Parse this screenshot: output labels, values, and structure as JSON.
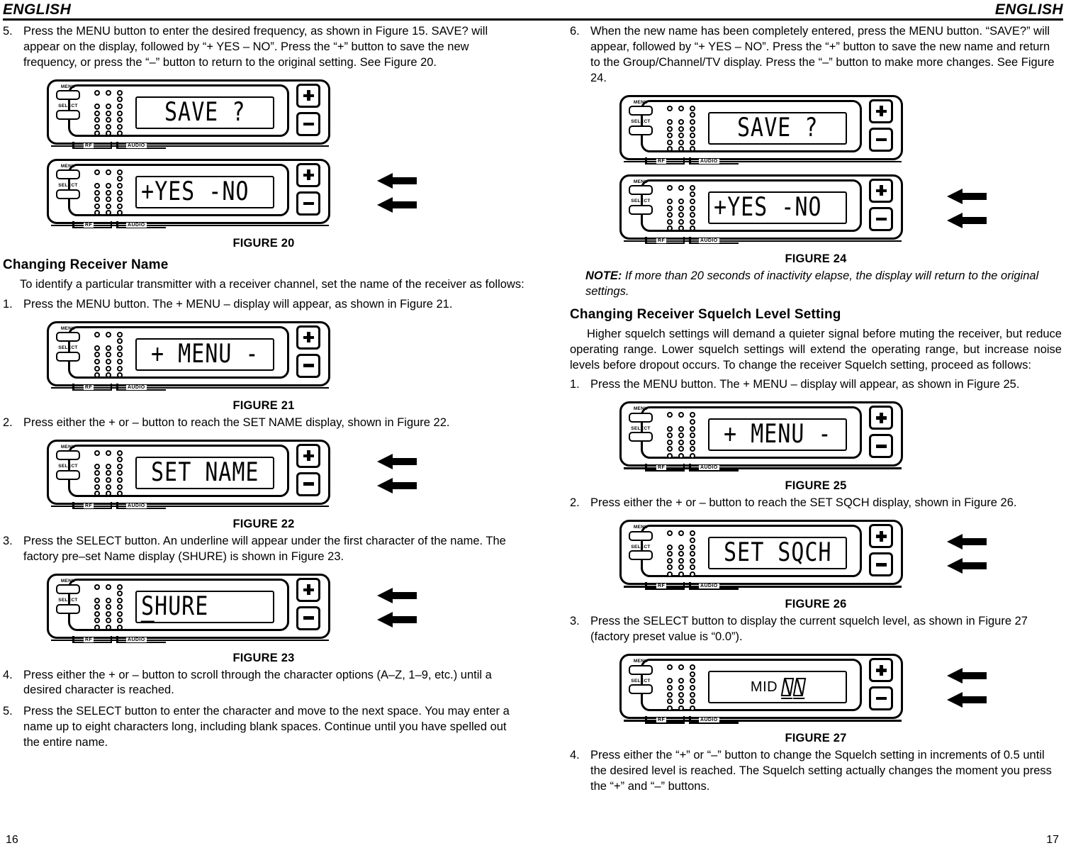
{
  "header": {
    "left_word": "ENGLISH",
    "right_word": "ENGLISH"
  },
  "page_numbers": {
    "left": "16",
    "right": "17"
  },
  "left_column": {
    "step5": {
      "num": "5.",
      "text": "Press the MENU button to enter the desired frequency, as shown in Figure 15. SAVE? will appear on the display, followed by “+ YES – NO”. Press the “+” button to save the new frequency, or press the “–” button to return to the original setting. See Figure 20."
    },
    "figure20": {
      "caption": "FIGURE 20",
      "panel_a": {
        "lcd": "SAVE ?",
        "align": "center"
      },
      "panel_b": {
        "lcd": "+YES -NO",
        "align": "left"
      }
    },
    "section_title": "Changing Receiver Name",
    "intro": "To identify a particular transmitter with a receiver channel, set the name of the receiver as follows:",
    "step1": {
      "num": "1.",
      "text": "Press the MENU button. The + MENU – display will appear, as shown in Figure 21."
    },
    "figure21": {
      "caption": "FIGURE 21",
      "lcd": "+ MENU -"
    },
    "step2": {
      "num": "2.",
      "text": "Press either the + or – button to reach the SET NAME display, shown in Figure 22."
    },
    "figure22": {
      "caption": "FIGURE 22",
      "lcd": "SET NAME"
    },
    "step3": {
      "num": "3.",
      "text": "Press the SELECT button. An underline will appear under the first character of the name. The factory pre–set Name display (SHURE) is shown in Figure 23."
    },
    "figure23": {
      "caption": "FIGURE 23",
      "lcd": "SHURE"
    },
    "step4": {
      "num": "4.",
      "text": "Press either the + or – button to scroll through the character options (A–Z, 1–9, etc.) until a desired character is reached."
    },
    "step5b": {
      "num": "5.",
      "text": "Press the SELECT button to enter the character and move to the next space. You may enter a  name up to eight characters long, including blank spaces. Continue until you have spelled out the entire name."
    }
  },
  "right_column": {
    "step6": {
      "num": "6.",
      "text": "When the new name has been completely entered, press the MENU button. “SAVE?” will appear, followed by “+ YES – NO”. Press the  “+” button to save the new name and return to the Group/Channel/TV display. Press the “–” button to make more changes. See Figure 24."
    },
    "figure24": {
      "caption": "FIGURE 24",
      "panel_a": {
        "lcd": "SAVE ?",
        "align": "center"
      },
      "panel_b": {
        "lcd": "+YES -NO",
        "align": "left"
      }
    },
    "note": {
      "label": "NOTE:",
      "text": " If more than 20 seconds of inactivity elapse, the display will return to the original settings."
    },
    "section_title": "Changing Receiver Squelch Level Setting",
    "intro": "Higher squelch settings will demand a quieter signal before muting the receiver, but reduce operating range. Lower squelch settings will extend the operating range, but increase noise levels before dropout occurs. To change the receiver Squelch setting, proceed as follows:",
    "step1": {
      "num": "1.",
      "text": "Press the MENU button. The + MENU – display will appear, as shown in Figure 25."
    },
    "figure25": {
      "caption": "FIGURE 25",
      "lcd": "+ MENU -"
    },
    "step2": {
      "num": "2.",
      "text": "Press either the + or – button to reach the SET SQCH display, shown in Figure 26."
    },
    "figure26": {
      "caption": "FIGURE 26",
      "lcd": "SET SQCH"
    },
    "step3": {
      "num": "3.",
      "text": "Press the SELECT button to display the current squelch level, as shown in Figure 27 (factory preset value is “0.0”)."
    },
    "figure27": {
      "caption": "FIGURE 27",
      "lcd_word": "MID",
      "lcd_digits": "00"
    },
    "step4": {
      "num": "4.",
      "text": "Press either the “+” or “–” button to change the Squelch setting in increments of 0.5 until the desired level is reached. The Squelch setting actually changes the moment you press the “+” and “–” buttons."
    }
  },
  "panel": {
    "menu_label": "MENU",
    "select_label": "SELECT",
    "rf_label": "RF",
    "audio_label": "AUDIO",
    "plus_label": "+",
    "minus_label": "–"
  }
}
